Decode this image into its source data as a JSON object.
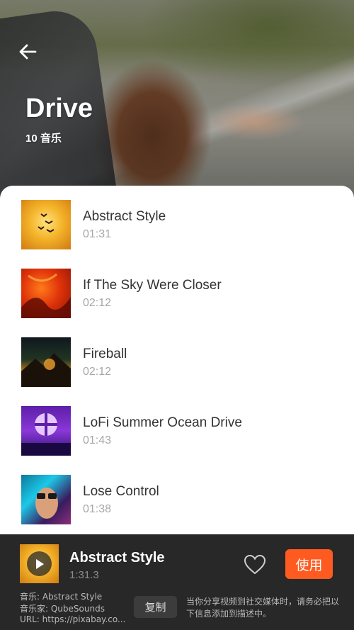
{
  "header": {
    "title": "Drive",
    "count_label": "10 音乐",
    "back_icon": "arrow-left-icon"
  },
  "tracks": [
    {
      "title": "Abstract Style",
      "duration": "01:31"
    },
    {
      "title": "If The Sky Were Closer",
      "duration": "02:12"
    },
    {
      "title": "Fireball",
      "duration": "02:12"
    },
    {
      "title": "LoFi Summer Ocean Drive",
      "duration": "01:43"
    },
    {
      "title": "Lose Control",
      "duration": "01:38"
    }
  ],
  "player": {
    "title": "Abstract Style",
    "time": "1:31.3",
    "use_label": "使用",
    "copy_label": "复制",
    "credit_music": "音乐: Abstract Style",
    "credit_artist": "音乐家: QubeSounds",
    "credit_url": "URL: https://pixabay.co...",
    "note": "当你分享视频到社交媒体时，请务必把以下信息添加到描述中。",
    "play_icon": "play-icon",
    "heart_icon": "heart-outline-icon"
  },
  "colors": {
    "accent": "#ff5a1f",
    "player_bg": "#282828"
  }
}
